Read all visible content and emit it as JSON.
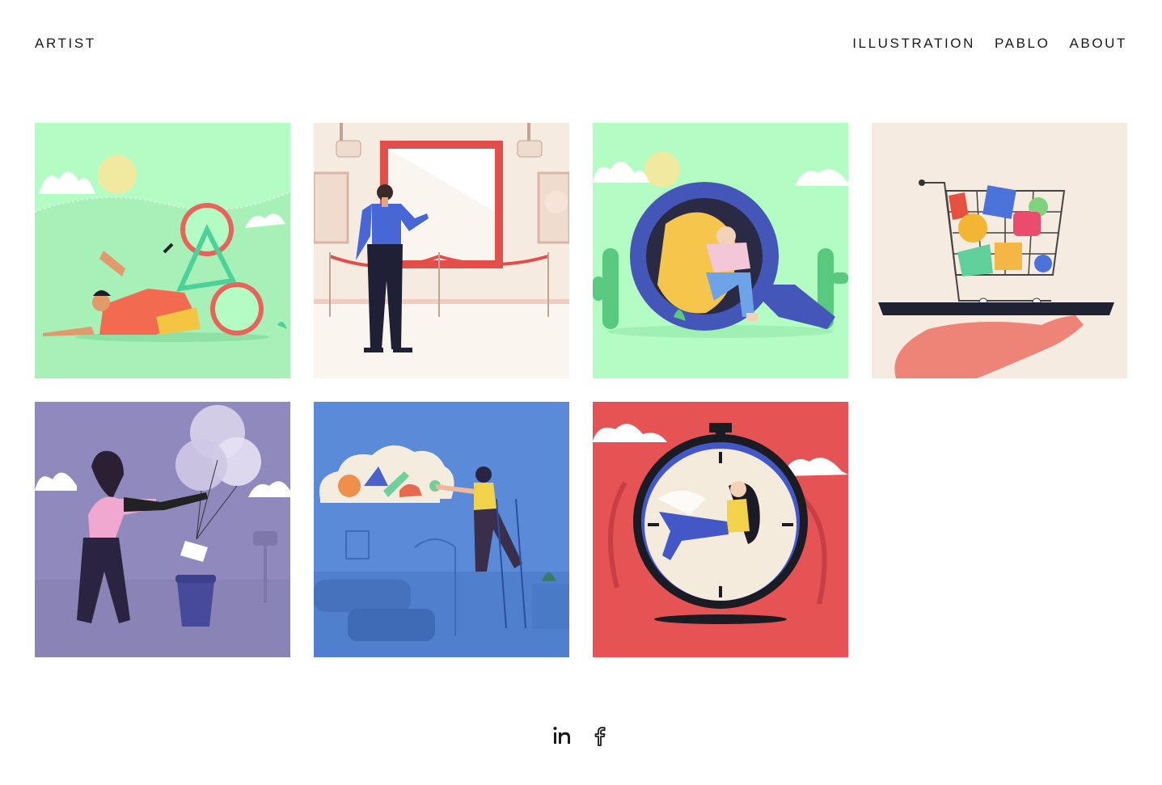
{
  "header": {
    "brand": "ARTIST",
    "nav": [
      {
        "label": "ILLUSTRATION"
      },
      {
        "label": "PABLO"
      },
      {
        "label": "ABOUT"
      }
    ]
  },
  "gallery": {
    "items": [
      {
        "subject": "cyclist-on-grass",
        "background": "#b3fcc4"
      },
      {
        "subject": "museum-visitor",
        "background": "#f6ebe1"
      },
      {
        "subject": "magnifying-glass-girl",
        "background": "#b3fcc4"
      },
      {
        "subject": "shopping-cart-on-tray",
        "background": "#f6ebe1"
      },
      {
        "subject": "woman-cutting-balloon-strings",
        "background": "#9089bd"
      },
      {
        "subject": "cloud-shelf-ladder",
        "background": "#5b8bd8"
      },
      {
        "subject": "stopwatch-woman",
        "background": "#e55354"
      }
    ]
  },
  "footer": {
    "social": [
      {
        "icon": "linkedin-icon"
      },
      {
        "icon": "facebook-icon"
      }
    ]
  }
}
